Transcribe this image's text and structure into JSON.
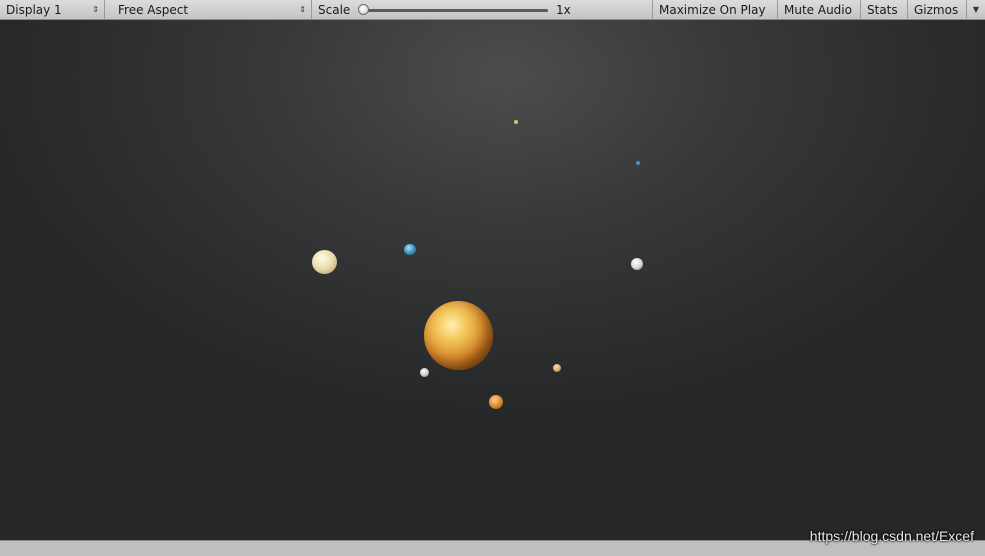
{
  "toolbar": {
    "display_label": "Display 1",
    "aspect_label": "Free Aspect",
    "scale_label": "Scale",
    "scale_value": "1x",
    "maximize_label": "Maximize On Play",
    "mute_label": "Mute Audio",
    "stats_label": "Stats",
    "gizmos_label": "Gizmos"
  },
  "scene": {
    "bodies": [
      {
        "name": "sun",
        "color": "#e0a04a"
      },
      {
        "name": "planet-cream",
        "color": "#e9dcb0"
      },
      {
        "name": "planet-blue",
        "color": "#3a8fb7"
      },
      {
        "name": "planet-white-right",
        "color": "#d9d9d9"
      },
      {
        "name": "planet-orange",
        "color": "#d9852a"
      },
      {
        "name": "planet-small-tan",
        "color": "#d8a56a"
      },
      {
        "name": "planet-small-grey",
        "color": "#c8c8c8"
      },
      {
        "name": "planet-tiny-blue",
        "color": "#4a8fd0"
      },
      {
        "name": "planet-tiny-yellow",
        "color": "#d8c070"
      }
    ]
  },
  "watermark": "https://blog.csdn.net/Excef"
}
